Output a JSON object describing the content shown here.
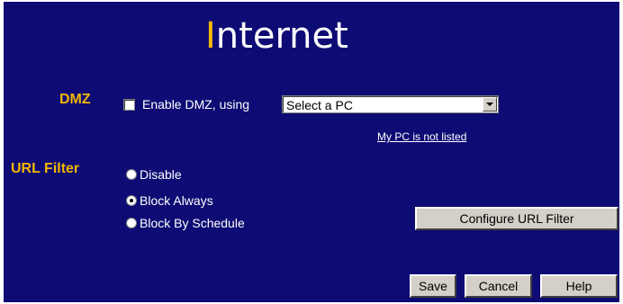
{
  "page": {
    "title_initial": "I",
    "title_rest": "nternet"
  },
  "dmz": {
    "label": "DMZ",
    "enable_label": "Enable DMZ, using",
    "enabled": false,
    "select_value": "Select a PC",
    "link_text": "My PC is not listed"
  },
  "url_filter": {
    "label": "URL Filter",
    "options": [
      {
        "label": "Disable",
        "checked": false
      },
      {
        "label": "Block Always",
        "checked": true
      },
      {
        "label": "Block By Schedule",
        "checked": false
      }
    ],
    "configure_button": "Configure URL Filter"
  },
  "buttons": {
    "save": "Save",
    "cancel": "Cancel",
    "help": "Help"
  },
  "colors": {
    "background": "#0e0b74",
    "accent": "#f2b700",
    "text": "#ffffff"
  }
}
